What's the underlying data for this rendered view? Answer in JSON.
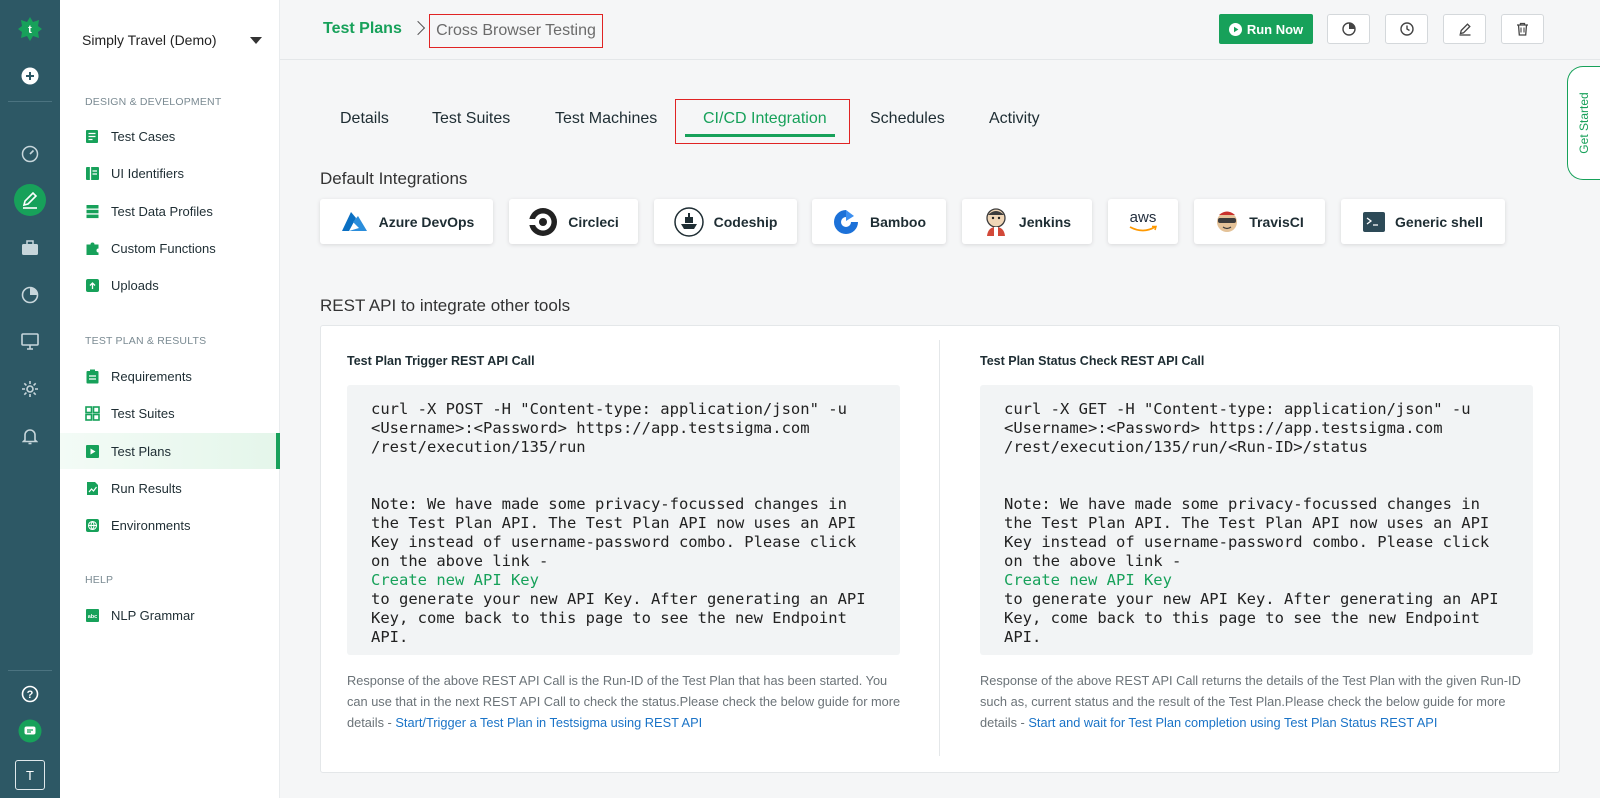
{
  "rail": {
    "user_initial": "T"
  },
  "sidebar": {
    "project": "Simply Travel (Demo)",
    "sections": [
      {
        "title": "DESIGN & DEVELOPMENT",
        "items": [
          {
            "label": "Test Cases",
            "icon": "test-cases-icon"
          },
          {
            "label": "UI Identifiers",
            "icon": "ui-identifiers-icon"
          },
          {
            "label": "Test Data Profiles",
            "icon": "test-data-icon"
          },
          {
            "label": "Custom Functions",
            "icon": "puzzle-icon"
          },
          {
            "label": "Uploads",
            "icon": "upload-icon"
          }
        ]
      },
      {
        "title": "TEST PLAN & RESULTS",
        "items": [
          {
            "label": "Requirements",
            "icon": "requirements-icon"
          },
          {
            "label": "Test Suites",
            "icon": "test-suites-icon"
          },
          {
            "label": "Test Plans",
            "icon": "play-icon",
            "active": true
          },
          {
            "label": "Run Results",
            "icon": "run-results-icon"
          },
          {
            "label": "Environments",
            "icon": "globe-icon"
          }
        ]
      },
      {
        "title": "HELP",
        "items": [
          {
            "label": "NLP Grammar",
            "icon": "abc-icon"
          }
        ]
      }
    ]
  },
  "header": {
    "breadcrumb_root": "Test Plans",
    "breadcrumb_current": "Cross Browser Testing",
    "run_now": "Run Now"
  },
  "tabs": [
    "Details",
    "Test Suites",
    "Test Machines",
    "CI/CD Integration",
    "Schedules",
    "Activity"
  ],
  "active_tab": "CI/CD Integration",
  "default_integrations_title": "Default Integrations",
  "integrations": [
    "Azure DevOps",
    "Circleci",
    "Codeship",
    "Bamboo",
    "Jenkins",
    "aws",
    "TravisCI",
    "Generic shell"
  ],
  "rest_title": "REST API to integrate other tools",
  "trigger": {
    "title": "Test Plan Trigger REST API Call",
    "code": "curl -X POST -H \"Content-type: application/json\" -u <Username>:<Password> https://app.testsigma.com /rest/execution/135/run",
    "note": "Note: We have made some privacy-focussed changes in the Test Plan API. The Test Plan API now uses an API Key instead of username-password combo. Please click on the above link -",
    "link": "Create new API Key",
    "note_after": "to generate your new API Key. After generating an API Key, come back to this page to see the new Endpoint API.",
    "desc": "Response of the above REST API Call is the Run-ID of the Test Plan that has been started. You can use that in the next REST API Call to check the status.Please check the below guide for more details - ",
    "desc_link": "Start/Trigger a Test Plan in Testsigma using REST API"
  },
  "status": {
    "title": "Test Plan Status Check REST API Call",
    "code": "curl -X GET -H \"Content-type: application/json\" -u <Username>:<Password> https://app.testsigma.com /rest/execution/135/run/<Run-ID>/status",
    "note": "Note: We have made some privacy-focussed changes in the Test Plan API. The Test Plan API now uses an API Key instead of username-password combo. Please click on the above link -",
    "link": "Create new API Key",
    "note_after": "to generate your new API Key. After generating an API Key, come back to this page to see the new Endpoint API.",
    "desc": "Response of the above REST API Call returns the details of the Test Plan with the given Run-ID such as, current status and the result of the Test Plan.Please check the below guide for more details - ",
    "desc_link": "Start and wait for Test Plan completion using Test Plan Status REST API"
  },
  "get_started": "Get Started",
  "colors": {
    "brand_green": "#17a15a",
    "rail": "#2d5865",
    "highlight_red": "#e02424",
    "link_blue": "#1a73c7"
  }
}
